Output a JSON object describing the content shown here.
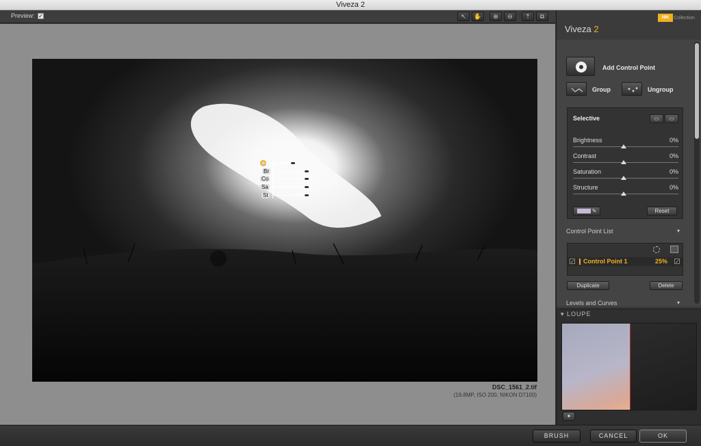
{
  "window": {
    "title": "Viveza 2"
  },
  "toolbar": {
    "preview_label": "Preview:",
    "preview_checked": "✓",
    "tools": [
      {
        "name": "arrow-tool-icon",
        "glyph": "↖"
      },
      {
        "name": "hand-tool-icon",
        "glyph": "✋"
      },
      {
        "name": "zoom-in-icon",
        "glyph": "⊕"
      },
      {
        "name": "zoom-out-icon",
        "glyph": "⊖"
      },
      {
        "name": "compare-icon",
        "glyph": "⇡"
      },
      {
        "name": "fullscreen-icon",
        "glyph": "⧉"
      }
    ]
  },
  "image": {
    "file_name": "DSC_1561_2.tif",
    "file_info": "(19.8MP, ISO 200, NIKON D7100)",
    "control_point_labels": [
      "Br",
      "Co",
      "Sa",
      "St"
    ]
  },
  "sidebar": {
    "brand_name": "Viveza",
    "brand_version": "2",
    "nik_logo": "NIK",
    "nik_collection": "Collection",
    "add_control_point_label": "Add Control Point",
    "group_label": "Group",
    "ungroup_label": "Ungroup",
    "selective": {
      "title": "Selective",
      "sliders": [
        {
          "name": "Brightness",
          "value": "0%"
        },
        {
          "name": "Contrast",
          "value": "0%"
        },
        {
          "name": "Saturation",
          "value": "0%"
        },
        {
          "name": "Structure",
          "value": "0%"
        }
      ],
      "reset_label": "Reset"
    },
    "control_point_list": {
      "title": "Control Point List",
      "item_label": "Control Point 1",
      "item_value": "25%",
      "duplicate_label": "Duplicate",
      "delete_label": "Delete"
    },
    "levels_curves_title": "Levels and Curves",
    "loupe_title": "▾ LOUPE"
  },
  "bottom": {
    "brush_label": "BRUSH",
    "cancel_label": "CANCEL",
    "ok_label": "OK"
  },
  "colors": {
    "accent": "#f0b020",
    "panel": "#3b3b3b",
    "canvas": "#8e8e8e"
  }
}
